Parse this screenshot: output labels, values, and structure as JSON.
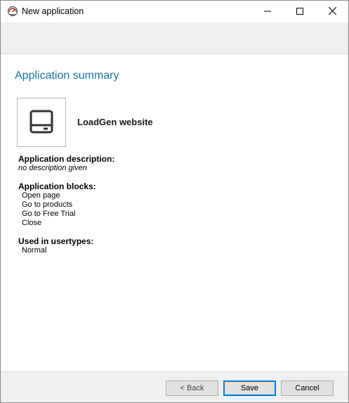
{
  "window": {
    "title": "New application",
    "icon": "gauge-icon",
    "controls": {
      "minimize_icon": "minimize-icon",
      "maximize_icon": "maximize-icon",
      "close_icon": "close-icon"
    }
  },
  "summary": {
    "heading": "Application summary",
    "app_icon": "monitor-icon",
    "app_name": "LoadGen website",
    "description_label": "Application description:",
    "description_value": "no description given",
    "blocks_label": "Application blocks:",
    "blocks": [
      "Open page",
      "Go to products",
      "Go to Free Trial",
      "Close"
    ],
    "usertypes_label": "Used in usertypes:",
    "usertypes": [
      "Normal"
    ]
  },
  "footer": {
    "back_label": "< Back",
    "save_label": "Save",
    "cancel_label": "Cancel"
  },
  "colors": {
    "heading": "#1a73a8",
    "default_button_border": "#0078d7",
    "band": "#f0f0f0"
  }
}
